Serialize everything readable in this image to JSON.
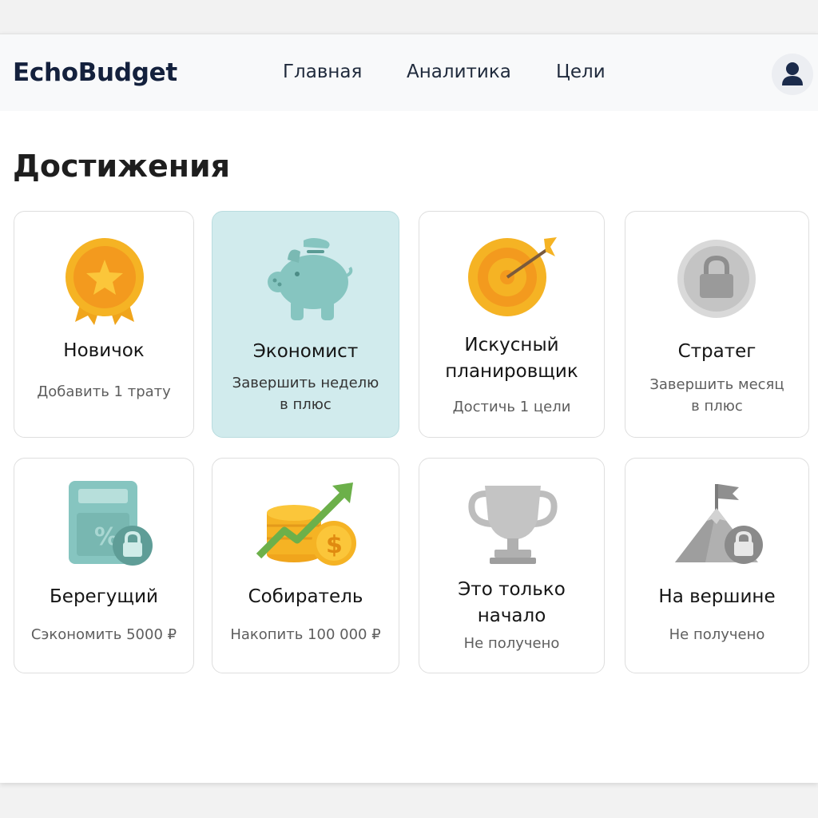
{
  "app": {
    "name": "EchoBudget"
  },
  "nav": {
    "items": [
      {
        "label": "Главная"
      },
      {
        "label": "Аналитика"
      },
      {
        "label": "Цели"
      }
    ]
  },
  "page": {
    "title": "Достижения"
  },
  "achievements": [
    {
      "title": "Новичок",
      "description": "Добавить 1 трату",
      "icon": "medal-star-icon",
      "status": "unlocked"
    },
    {
      "title": "Экономист",
      "description": "Завершить неделю в плюс",
      "icon": "piggy-bank-icon",
      "status": "highlighted"
    },
    {
      "title": "Искусный планировщик",
      "description": "Достичь 1 цели",
      "icon": "target-icon",
      "status": "unlocked"
    },
    {
      "title": "Стратег",
      "description": "Завершить месяц в плюс",
      "icon": "locked-coin-icon",
      "status": "locked"
    },
    {
      "title": "Берегущий",
      "description": "Сэкономить 5000 ₽",
      "icon": "calculator-lock-icon",
      "status": "locked"
    },
    {
      "title": "Собиратель",
      "description": "Накопить 100 000 ₽",
      "icon": "coins-growth-icon",
      "status": "unlocked"
    },
    {
      "title": "Это только начало",
      "description": "Не получено",
      "icon": "trophy-icon",
      "status": "locked"
    },
    {
      "title": "На вершине",
      "description": "Не получено",
      "icon": "mountain-flag-icon",
      "status": "locked"
    }
  ],
  "colors": {
    "brand": "#14213d",
    "highlight": "#d1ebed",
    "gold": "#f5b324",
    "teal": "#86c5c0",
    "locked_gray": "#a8a8a8"
  }
}
